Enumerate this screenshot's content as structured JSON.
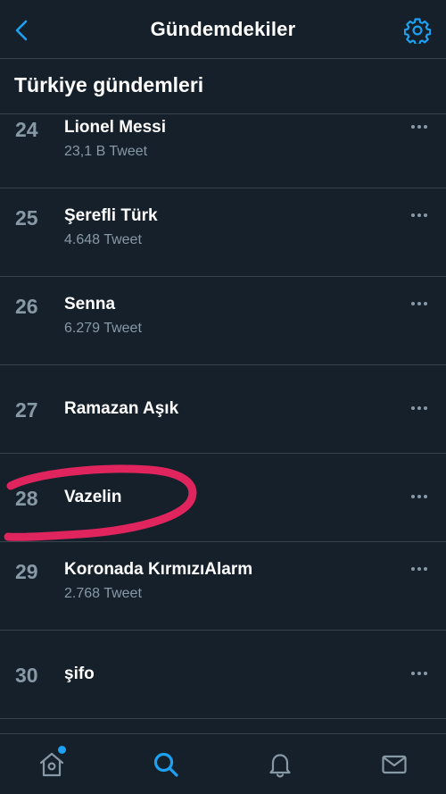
{
  "header": {
    "title": "Gündemdekiler",
    "back_icon": "chevron-left-icon",
    "settings_icon": "gear-icon"
  },
  "section": {
    "title": "Türkiye gündemleri"
  },
  "trends": [
    {
      "rank": "24",
      "name": "Lionel Messi",
      "count": "23,1 B Tweet"
    },
    {
      "rank": "25",
      "name": "Şerefli Türk",
      "count": "4.648 Tweet"
    },
    {
      "rank": "26",
      "name": "Senna",
      "count": "6.279 Tweet"
    },
    {
      "rank": "27",
      "name": "Ramazan Aşık"
    },
    {
      "rank": "28",
      "name": "Vazelin",
      "highlighted": true
    },
    {
      "rank": "29",
      "name": "Koronada KırmızıAlarm",
      "count": "2.768 Tweet"
    },
    {
      "rank": "30",
      "name": "şifo"
    }
  ],
  "tabbar": {
    "items": [
      {
        "icon": "home-icon",
        "active": false,
        "has_notification_dot": true
      },
      {
        "icon": "search-icon",
        "active": true
      },
      {
        "icon": "bell-icon",
        "active": false
      },
      {
        "icon": "mail-icon",
        "active": false
      }
    ]
  },
  "colors": {
    "background": "#15202b",
    "accent": "#1da1f2",
    "muted_text": "#8899a6",
    "divider": "#38444d",
    "highlight_circle": "#e0245e"
  }
}
